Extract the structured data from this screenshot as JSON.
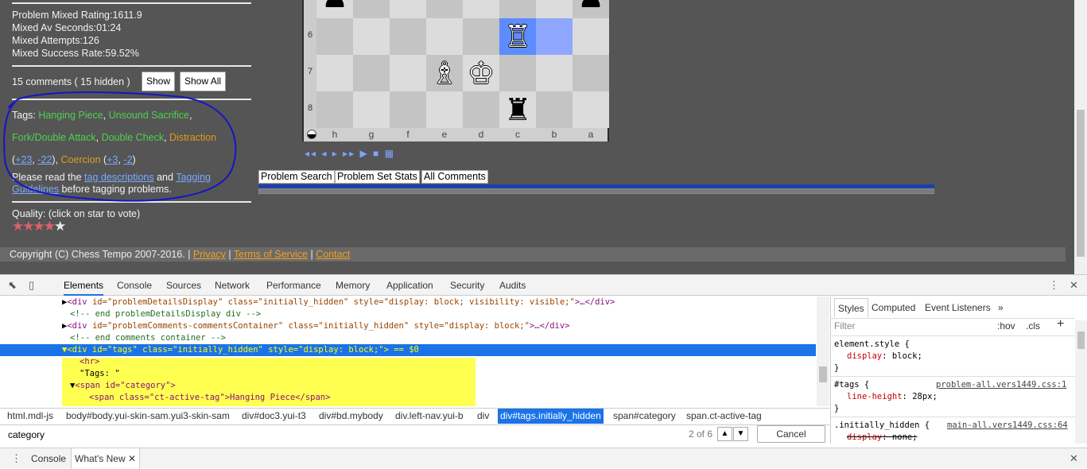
{
  "page": {
    "stats": [
      "Problem Mixed Rating:1611.9",
      "Mixed Av Seconds:01:24",
      "Mixed Attempts:126",
      "Mixed Success Rate:59.52%"
    ],
    "comments": {
      "count_text": "15 comments ( 15 hidden )",
      "show_label": "Show",
      "show_all_label": "Show All"
    },
    "tags": {
      "prefix": "Tags: ",
      "hanging_piece": "Hanging Piece",
      "comma1": ", ",
      "unsound_sacrifice": "Unsound Sacrifice",
      "comma2": ",",
      "fork_double_attack": "Fork/Double Attack",
      "comma3": ", ",
      "double_check": "Double Check",
      "comma4": ", ",
      "distraction": "Distraction",
      "open_paren1": "(",
      "plus23": "+23",
      "comma5": ", ",
      "minus22": "-22",
      "close_paren1": "), ",
      "coercion": "Coercion",
      "open_paren2": " (",
      "plus3": "+3",
      "comma6": ", ",
      "minus2": "-2",
      "close_paren2": ")",
      "please_read": "Please read the ",
      "tag_descriptions": "tag descriptions",
      "and": " and ",
      "tagging": "Tagging",
      "guidelines": "Guidelines",
      "before": " before tagging problems."
    },
    "quality": {
      "label": "Quality: (click on star to vote)",
      "stars_filled": 4,
      "stars_total": 5
    },
    "board": {
      "ranks": [
        "6",
        "7",
        "8"
      ],
      "files": [
        "h",
        "g",
        "f",
        "e",
        "d",
        "c",
        "b",
        "a"
      ],
      "pieces": [
        {
          "glyph": "♟",
          "color": "black",
          "name": "black-pawn-h5"
        },
        {
          "glyph": "♟",
          "color": "black",
          "name": "black-pawn-a5"
        },
        {
          "glyph": "♖",
          "color": "white",
          "name": "white-rook-c6"
        },
        {
          "glyph": "♗",
          "color": "white",
          "name": "white-bishop-e7"
        },
        {
          "glyph": "♔",
          "color": "white",
          "name": "white-king-d7"
        },
        {
          "glyph": "♜",
          "color": "black",
          "name": "black-rook-c8"
        }
      ]
    },
    "nav_buttons": "◂◂ ◂ ▸ ▸▸ ▶ ■ ▦",
    "tabs": [
      "Problem Search",
      "Problem Set Stats",
      "All Comments"
    ],
    "copyright": {
      "text": "Copyright (C) Chess Tempo 2007-2016. | ",
      "privacy": "Privacy",
      "sep1": " | ",
      "terms": "Terms of Service",
      "sep2": " | ",
      "contact": "Contact"
    }
  },
  "devtools": {
    "tabs": [
      "Elements",
      "Console",
      "Sources",
      "Network",
      "Performance",
      "Memory",
      "Application",
      "Security",
      "Audits"
    ],
    "active_tab": "Elements",
    "dom_lines": {
      "l1_tag": "div",
      "l1_attrs": " id=\"problemDetailsDisplay\" class=\"initially_hidden\" style=\"display: block; visibility: visible;\"",
      "l1_tail": ">…</div>",
      "l2": "<!-- end problemDetailsDisplay div -->",
      "l3_tag": "div",
      "l3_attrs": " id=\"problemComments-commentsContainer\" class=\"initially_hidden\" style=\"display: block;\"",
      "l3_tail": ">…</div>",
      "l4": "<!-- end comments container -->",
      "l5_text": "<div id=\"tags\" class=\"initially_hidden\" style=\"display: block;\"> == $0",
      "l6": "<hr>",
      "l7": "\"Tags: \"",
      "l8": "<span id=\"category\">",
      "l9": "<span class=\"ct-active-tag\">Hanging Piece</span>"
    },
    "breadcrumbs": [
      "html.mdl-js",
      "body#body.yui-skin-sam.yui3-skin-sam",
      "div#doc3.yui-t3",
      "div#bd.mybody",
      "div.left-nav.yui-b",
      "div",
      "div#tags.initially_hidden",
      "span#category",
      "span.ct-active-tag"
    ],
    "active_crumb": "div#tags.initially_hidden",
    "search": {
      "value": "category",
      "match_count": "2 of 6",
      "cancel_label": "Cancel"
    },
    "styles": {
      "tabs": [
        "Styles",
        "Computed",
        "Event Listeners"
      ],
      "filter_placeholder": "Filter",
      "hov": ":hov",
      "cls": ".cls",
      "rule1_selector": "element.style {",
      "rule1_prop": "display",
      "rule1_val": "block;",
      "close_brace": "}",
      "rule2_selector": "#tags {",
      "rule2_src": "problem-all.vers1449.css:1",
      "rule2_prop": "line-height",
      "rule2_val": "28px;",
      "rule3_selector": ".initially_hidden {",
      "rule3_src": "main-all.vers1449.css:64",
      "rule3_prop": "display",
      "rule3_val": "none;"
    },
    "drawer": {
      "tabs": [
        "Console",
        "What's New"
      ],
      "active": "What's New"
    }
  },
  "colors": {
    "page_bg": "#555555",
    "tag_green": "#4fd14f",
    "tag_orange": "#e39a18",
    "annotation_blue": "#1515c8",
    "highlight_yellow": "#ffff33",
    "devtools_accent": "#1a73e8"
  }
}
